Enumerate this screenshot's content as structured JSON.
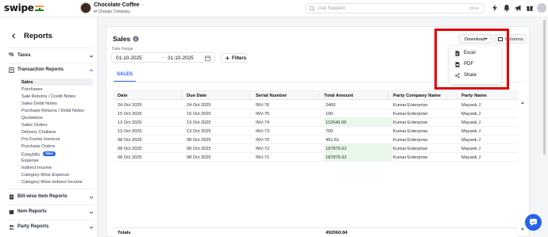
{
  "topbar": {
    "logo": "swipe",
    "company_name": "Chocolate Coffee",
    "change_company": "Change Company",
    "search_placeholder": "Ask SwipeAI",
    "search_shortcut": "ctrl+k",
    "flag_colors": [
      "#ff9933",
      "#ffffff",
      "#138808"
    ]
  },
  "sidebar": {
    "title": "Reports",
    "sections": [
      {
        "label": "Taxes",
        "icon": "percent-icon",
        "expanded": false
      },
      {
        "label": "Transaction Reports",
        "icon": "document-icon",
        "expanded": true
      },
      {
        "label": "Bill-wise Item Reports",
        "icon": "bill-icon",
        "expanded": false
      },
      {
        "label": "Item Reports",
        "icon": "box-icon",
        "expanded": false
      },
      {
        "label": "Party Reports",
        "icon": "users-icon",
        "expanded": false
      }
    ],
    "transaction_items": [
      "Sales",
      "Purchases",
      "Sale Returns / Credit Notes",
      "Sales Debit Notes",
      "Purchase Returns / Debit Notes",
      "Quotations",
      "Sales Orders",
      "Delivery Challans",
      "Pro Forma Invoices",
      "Purchase Orders",
      "Ewaybills",
      "Expense",
      "Indirect Income",
      "Category-Wise Expense",
      "Category-Wise Indirect Income"
    ],
    "new_badge": "New",
    "active_item": "Sales"
  },
  "main": {
    "title": "Sales",
    "date_range_label": "Date Range",
    "date_from": "01-10-2025",
    "date_arrow": "→",
    "date_to": "31-10-2025",
    "filters_label": "Filters",
    "tab": "SALES",
    "download_label": "Download",
    "columns_label": "Columns",
    "download_menu": [
      "Excel",
      "PDF",
      "Share"
    ],
    "highlight_color": "#e00000",
    "accent_color": "#2563eb"
  },
  "table": {
    "headers": [
      "Date",
      "Due Date",
      "Serial Number",
      "Total Amount",
      "Party Company Name",
      "Party Name"
    ],
    "rows": [
      [
        "24 Oct 2025",
        "24 Oct 2025",
        "INV-76",
        "2400",
        "Kumar Enterprise",
        "Mayank J"
      ],
      [
        "15 Oct 2025",
        "15 Oct 2025",
        "INV-75",
        "100",
        "Kumar Enterprise",
        "Mayank J"
      ],
      [
        "13 Oct 2025",
        "13 Oct 2025",
        "INV-74",
        "112649.99",
        "Kumar Enterprise",
        "Mayank J"
      ],
      [
        "13 Oct 2025",
        "13 Oct 2025",
        "INV-73",
        "700",
        "Kumar Enterprise",
        "Mayank J"
      ],
      [
        "08 Oct 2025",
        "08 Oct 2025",
        "INV-70",
        "451.61",
        "Kumar Enterprise",
        "Mayank J"
      ],
      [
        "08 Oct 2025",
        "08 Oct 2025",
        "INV-72",
        "187879.62",
        "Kumar Enterprise",
        "Mayank J"
      ],
      [
        "08 Oct 2025",
        "08 Oct 2025",
        "INV-71",
        "187879.62",
        "Kumar Enterprise",
        "Mayank J"
      ]
    ],
    "footer_label": "Totals",
    "footer_total": "492060.84"
  }
}
